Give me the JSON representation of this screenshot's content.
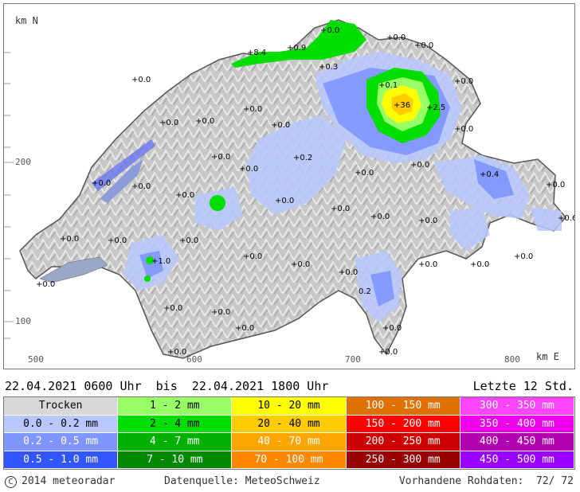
{
  "map": {
    "y_axis_label": "km N",
    "x_axis_label": "km E",
    "x_ticks": [
      "500",
      "600",
      "700",
      "800"
    ],
    "y_ticks": [
      "200",
      "100"
    ],
    "annotations": [
      {
        "text": "+0.0"
      },
      {
        "text": "+8.4"
      },
      {
        "text": "+0.9"
      },
      {
        "text": "+0.0"
      },
      {
        "text": "+0.0"
      },
      {
        "text": "+0.3"
      },
      {
        "text": "+0.1"
      },
      {
        "text": "+36"
      },
      {
        "text": "+2.5"
      },
      {
        "text": "+0.0"
      },
      {
        "text": "+0.2"
      },
      {
        "text": "+0.4"
      },
      {
        "text": "+0.6"
      },
      {
        "text": "+1.0"
      },
      {
        "text": "0.2"
      }
    ]
  },
  "period": {
    "range": "22.04.2021 0600 Uhr  bis  22.04.2021 1800 Uhr",
    "last": "Letzte 12 Std."
  },
  "legend": [
    {
      "label": "Trocken",
      "color": "#d8d8d8",
      "text_color": "#000000"
    },
    {
      "label": "1 - 2 mm",
      "color": "#99ff66",
      "text_color": "#000000"
    },
    {
      "label": "10 - 20 mm",
      "color": "#ffff00",
      "text_color": "#000000"
    },
    {
      "label": "100 - 150 mm",
      "color": "#e07000",
      "text_color": "#ffffff"
    },
    {
      "label": "300 - 350 mm",
      "color": "#ff44ff",
      "text_color": "#ffffff"
    },
    {
      "label": "0.0 - 0.2 mm",
      "color": "#b8c8ff",
      "text_color": "#000000"
    },
    {
      "label": "2 - 4 mm",
      "color": "#00dd00",
      "text_color": "#000000"
    },
    {
      "label": "20 - 40 mm",
      "color": "#ffcc00",
      "text_color": "#000000"
    },
    {
      "label": "150 - 200 mm",
      "color": "#ff0000",
      "text_color": "#ffffff"
    },
    {
      "label": "350 - 400 mm",
      "color": "#ee00ee",
      "text_color": "#ffffff"
    },
    {
      "label": "0.2 - 0.5 mm",
      "color": "#7f95ff",
      "text_color": "#ffffff"
    },
    {
      "label": "4 - 7 mm",
      "color": "#00b000",
      "text_color": "#ffffff"
    },
    {
      "label": "40 - 70 mm",
      "color": "#ffa500",
      "text_color": "#ffffff"
    },
    {
      "label": "200 - 250 mm",
      "color": "#cc0000",
      "text_color": "#ffffff"
    },
    {
      "label": "400 - 450 mm",
      "color": "#b000b0",
      "text_color": "#ffffff"
    },
    {
      "label": "0.5 - 1.0 mm",
      "color": "#3355ff",
      "text_color": "#ffffff"
    },
    {
      "label": "7 - 10 mm",
      "color": "#008800",
      "text_color": "#ffffff"
    },
    {
      "label": "70 - 100 mm",
      "color": "#ff8800",
      "text_color": "#ffffff"
    },
    {
      "label": "250 - 300 mm",
      "color": "#990000",
      "text_color": "#ffffff"
    },
    {
      "label": "450 - 500 mm",
      "color": "#9900ff",
      "text_color": "#ffffff"
    }
  ],
  "footer": {
    "copyright": "2014  meteoradar",
    "source": "Datenquelle: MeteoSchweiz",
    "raw": "Vorhandene Rohdaten:  72/ 72"
  }
}
